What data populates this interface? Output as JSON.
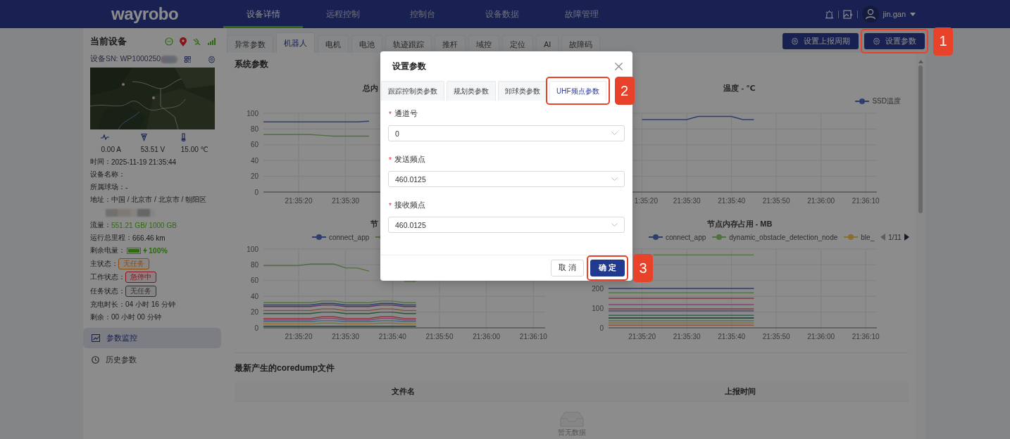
{
  "topbar": {
    "logo": "wayrobo",
    "nav": [
      {
        "label": "设备详情",
        "selected": true
      },
      {
        "label": "远程控制",
        "selected": false
      },
      {
        "label": "控制台",
        "selected": false
      },
      {
        "label": "设备数据",
        "selected": false
      },
      {
        "label": "故障管理",
        "selected": false
      }
    ],
    "user": {
      "name": "jin.gan"
    }
  },
  "sidebar": {
    "title": "当前设备",
    "sn_label": "设备SN: WP1000250",
    "map": {
      "kind": "picture"
    },
    "stats": [
      "0.00 A",
      "53.51 V",
      "15.00 ℃"
    ],
    "info": [
      {
        "kind": "text",
        "label": "时间：",
        "value": "2025-11-19 21:35:44"
      },
      {
        "kind": "text",
        "label": "设备名称："
      },
      {
        "kind": "text",
        "label": "所属球场：",
        "value": "-"
      },
      {
        "kind": "text",
        "label": "地址：",
        "value": "中国 / 北京市 / 北京市 / 朝阳区"
      },
      {
        "kind": "redacted"
      },
      {
        "kind": "text",
        "label": "流量：",
        "value": "551.21 GB/ 1000 GB",
        "color": "#2d6c0e"
      },
      {
        "kind": "text",
        "label": "运行总里程：",
        "value": "666.46 km"
      },
      {
        "kind": "battery",
        "label": "剩余电量：",
        "level": 1,
        "value": "100%"
      },
      {
        "kind": "tag",
        "label": "主状态：",
        "value": "无任务",
        "color": "#8a4d0c"
      },
      {
        "kind": "tag",
        "label": "工作状态：",
        "value": "急停中",
        "color": "#871319"
      },
      {
        "kind": "tag",
        "label": "任务状态：",
        "value": "无任务",
        "color": "#313131"
      },
      {
        "kind": "text",
        "label": "充电时长：",
        "value": "04 小时 16 分钟"
      },
      {
        "kind": "text",
        "label": "剩余：",
        "value": "00 小时 00 分钟"
      }
    ],
    "menu": [
      {
        "label": "参数监控",
        "selected": true
      },
      {
        "label": "历史参数",
        "selected": false
      }
    ]
  },
  "main_tabs": [
    {
      "label": "异常参数",
      "selected": false
    },
    {
      "label": "机器人",
      "selected": true
    },
    {
      "label": "电机",
      "selected": false
    },
    {
      "label": "电池",
      "selected": false
    },
    {
      "label": "轨迹跟踪",
      "selected": false
    },
    {
      "label": "推杆",
      "selected": false
    },
    {
      "label": "域控",
      "selected": false
    },
    {
      "label": "定位",
      "selected": false
    },
    {
      "label": "AI",
      "selected": false
    },
    {
      "label": "故障码",
      "selected": false
    }
  ],
  "actions": [
    {
      "label": "设置上报周期"
    },
    {
      "label": "设置参数",
      "annotation": "1"
    }
  ],
  "panel": {
    "title": "系统参数",
    "charts": [
      {
        "chart_data": {
          "type": "line",
          "title": "总内",
          "grid": true,
          "ylim": [
            0,
            100
          ],
          "yticks": [
            0,
            20,
            40,
            60,
            80,
            100
          ],
          "categories": [
            null,
            null,
            null,
            "21:35:20",
            null,
            null,
            null,
            "21:35:30",
            null,
            null,
            null,
            null,
            null,
            null,
            null,
            null,
            null,
            null,
            null,
            null,
            null,
            null,
            null,
            null,
            null
          ],
          "series": [
            {
              "color": "#2e3e6d",
              "values": [
                89,
                89,
                89,
                89,
                89,
                89,
                89,
                89,
                89,
                90,
                null,
                null,
                null,
                null,
                null,
                null,
                null,
                null,
                null,
                null,
                null,
                null,
                null,
                null,
                null
              ]
            },
            {
              "color": "#507040",
              "values": [
                73,
                73,
                73,
                73,
                73,
                72,
                71,
                71,
                71,
                71,
                null,
                null,
                null,
                null,
                null,
                null,
                null,
                null,
                null,
                null,
                null,
                null,
                null,
                null,
                null
              ]
            }
          ]
        }
      },
      {
        "partial_tick_label": "1:35:20",
        "chart_data": {
          "type": "line",
          "title": "温度 - ℃",
          "grid": true,
          "ylim": [
            0,
            100
          ],
          "categories": [
            null,
            null,
            null,
            null,
            null,
            null,
            null,
            "21:35:30",
            null,
            null,
            null,
            "21:35:40",
            null,
            null,
            null,
            "21:35:50",
            null,
            null,
            null,
            "21:36:00",
            null,
            null,
            null,
            "21:36:10",
            null
          ],
          "series": [
            {
              "name": "SSD温度",
              "color": "#2e3e6d",
              "values": [
                null,
                null,
                null,
                92,
                92,
                92,
                92,
                92,
                96,
                96,
                96,
                96,
                92,
                92,
                null,
                null,
                null,
                null,
                null,
                null,
                null,
                null,
                null,
                null,
                null
              ]
            }
          ]
        }
      },
      {
        "chart_data": {
          "type": "line",
          "title": "节",
          "grid": true,
          "ylim": [
            0,
            100
          ],
          "yticks": [
            0,
            20,
            40,
            60,
            80,
            100
          ],
          "categories": [
            null,
            null,
            null,
            "21:35:20",
            null,
            null,
            null,
            "21:35:30",
            null,
            null,
            null,
            "21:35:40",
            null,
            null,
            null,
            "21:35:50",
            null,
            null,
            null,
            "21:36:00",
            null,
            null,
            null,
            "21:36:10",
            null
          ],
          "series": [
            {
              "name": "connect_app",
              "color": "#2e3e6d",
              "values": [
                29,
                29,
                29,
                29,
                29,
                31,
                31,
                29,
                29,
                29,
                31,
                31,
                29,
                29,
                null,
                null,
                null,
                null,
                null,
                null,
                null,
                null,
                null,
                null,
                null
              ]
            },
            {
              "color": "#507040",
              "values": [
                79,
                79,
                79,
                79,
                81,
                81,
                81,
                76,
                76,
                72,
                null,
                null,
                59,
                59,
                null,
                null,
                null,
                null,
                null,
                null,
                null,
                null,
                null,
                null,
                null
              ]
            },
            {
              "color": "#587246",
              "values": [
                32,
                32,
                32,
                32,
                32,
                34,
                34,
                32,
                32,
                32,
                34,
                34,
                32,
                32,
                null,
                null,
                null,
                null,
                null,
                null,
                null,
                null,
                null,
                null,
                null
              ]
            },
            {
              "color": "#553563",
              "values": [
                27,
                27,
                27,
                27,
                27,
                29,
                29,
                27,
                27,
                27,
                29,
                29,
                27,
                27,
                null,
                null,
                null,
                null,
                null,
                null,
                null,
                null,
                null,
                null,
                null
              ]
            },
            {
              "color": "#8b492d",
              "values": [
                22,
                22,
                22,
                22,
                22,
                24,
                24,
                22,
                22,
                22,
                24,
                24,
                22,
                22,
                null,
                null,
                null,
                null,
                null,
                null,
                null,
                null,
                null,
                null,
                null
              ]
            },
            {
              "color": "#20593f",
              "values": [
                18,
                18,
                18,
                18,
                18,
                20,
                20,
                18,
                18,
                18,
                20,
                20,
                18,
                18,
                null,
                null,
                null,
                null,
                null,
                null,
                null,
                null,
                null,
                null,
                null
              ]
            },
            {
              "color": "#833838",
              "values": [
                12,
                12,
                12,
                12,
                12,
                14,
                14,
                12,
                12,
                12,
                14,
                14,
                12,
                12,
                null,
                null,
                null,
                null,
                null,
                null,
                null,
                null,
                null,
                null,
                null
              ]
            },
            {
              "color": "#814470",
              "values": [
                10,
                10,
                10,
                10,
                10,
                12,
                12,
                10,
                10,
                10,
                12,
                12,
                10,
                10,
                null,
                null,
                null,
                null,
                null,
                null,
                null,
                null,
                null,
                null,
                null
              ]
            },
            {
              "color": "#3f6a7a",
              "values": [
                8,
                8,
                8,
                8,
                8,
                9,
                9,
                8,
                8,
                8,
                9,
                9,
                8,
                8,
                null,
                null,
                null,
                null,
                null,
                null,
                null,
                null,
                null,
                null,
                null
              ]
            },
            {
              "color": "#8a6e30",
              "values": [
                5,
                5,
                5,
                5,
                5,
                6,
                6,
                5,
                5,
                5,
                6,
                6,
                5,
                5,
                null,
                null,
                null,
                null,
                null,
                null,
                null,
                null,
                null,
                null,
                null
              ]
            },
            {
              "color": "#19452b",
              "values": [
                2,
                2,
                2,
                2,
                2,
                2,
                2,
                2,
                2,
                2,
                2,
                2,
                2,
                2,
                null,
                null,
                null,
                null,
                null,
                null,
                null,
                null,
                null,
                null,
                null
              ]
            }
          ]
        }
      },
      {
        "legend_pager": "1/11",
        "chart_data": {
          "type": "line",
          "title": "节点内存占用 - MB",
          "grid": true,
          "ylim": [
            0,
            400
          ],
          "yticks": [
            0,
            100,
            200
          ],
          "categories": [
            null,
            null,
            null,
            "21:35:20",
            null,
            null,
            null,
            "21:35:30",
            null,
            null,
            null,
            "21:35:40",
            null,
            null,
            null,
            "21:35:50",
            null,
            null,
            null,
            "21:36:00",
            null,
            null,
            null,
            "21:36:10",
            null
          ],
          "series": [
            {
              "name": "connect_app",
              "color": "#2e3e6d",
              "values": [
                200,
                200,
                200,
                200,
                200,
                200,
                200,
                200,
                200,
                200,
                200,
                200,
                200,
                200,
                null,
                null,
                null,
                null,
                null,
                null,
                null,
                null,
                null,
                null,
                null
              ]
            },
            {
              "name": "dynamic_obstacle_detection_node",
              "color": "#507040",
              "values": [
                null,
                null,
                null,
                null,
                370,
                370,
                370,
                370,
                370,
                370,
                370,
                370,
                370,
                370,
                null,
                null,
                null,
                null,
                null,
                null,
                null,
                null,
                null,
                null,
                null
              ]
            },
            {
              "name": "ble_",
              "color": "#8a6e30",
              "values": [
                25,
                25,
                25,
                25,
                25,
                25,
                25,
                25,
                25,
                25,
                25,
                25,
                25,
                25,
                null,
                null,
                null,
                null,
                null,
                null,
                null,
                null,
                null,
                null,
                null
              ]
            },
            {
              "color": "#577243",
              "values": [
                178,
                178,
                178,
                178,
                178,
                178,
                178,
                178,
                178,
                178,
                178,
                178,
                178,
                178,
                null,
                null,
                null,
                null,
                null,
                null,
                null,
                null,
                null,
                null,
                null
              ]
            },
            {
              "color": "#833838",
              "values": [
                150,
                150,
                150,
                150,
                150,
                150,
                150,
                150,
                150,
                150,
                150,
                150,
                150,
                150,
                null,
                null,
                null,
                null,
                null,
                null,
                null,
                null,
                null,
                null,
                null
              ]
            },
            {
              "color": "#814470",
              "values": [
                118,
                118,
                118,
                118,
                118,
                118,
                118,
                118,
                118,
                118,
                118,
                118,
                118,
                118,
                null,
                null,
                null,
                null,
                null,
                null,
                null,
                null,
                null,
                null,
                null
              ]
            },
            {
              "color": "#732935",
              "values": [
                96,
                96,
                96,
                96,
                96,
                96,
                96,
                96,
                96,
                96,
                96,
                96,
                96,
                96,
                null,
                null,
                null,
                null,
                null,
                null,
                null,
                null,
                null,
                null,
                null
              ]
            },
            {
              "color": "#553563",
              "values": [
                86,
                86,
                86,
                86,
                86,
                86,
                86,
                86,
                86,
                86,
                86,
                86,
                86,
                86,
                null,
                null,
                null,
                null,
                null,
                null,
                null,
                null,
                null,
                null,
                null
              ]
            },
            {
              "color": "#20593f",
              "values": [
                64,
                64,
                64,
                64,
                64,
                64,
                64,
                64,
                64,
                64,
                64,
                64,
                64,
                64,
                null,
                null,
                null,
                null,
                null,
                null,
                null,
                null,
                null,
                null,
                null
              ]
            },
            {
              "color": "#113b20",
              "values": [
                50,
                50,
                50,
                50,
                50,
                50,
                50,
                50,
                50,
                50,
                50,
                50,
                50,
                50,
                null,
                null,
                null,
                null,
                null,
                null,
                null,
                null,
                null,
                null,
                null
              ]
            },
            {
              "color": "#3f6a7a",
              "values": [
                36,
                36,
                36,
                36,
                36,
                36,
                36,
                36,
                36,
                36,
                36,
                36,
                36,
                36,
                null,
                null,
                null,
                null,
                null,
                null,
                null,
                null,
                null,
                null,
                null
              ]
            },
            {
              "color": "#8b492d",
              "values": [
                14,
                14,
                14,
                14,
                14,
                14,
                14,
                14,
                14,
                14,
                14,
                14,
                14,
                14,
                null,
                null,
                null,
                null,
                null,
                null,
                null,
                null,
                null,
                null,
                null
              ]
            }
          ]
        }
      }
    ],
    "coredump": {
      "title": "最新产生的coredump文件",
      "columns": [
        "文件名",
        "上报时间"
      ],
      "empty_text": "暂无数据"
    }
  },
  "dialog": {
    "title": "设置参数",
    "tabs": [
      {
        "label": "跟踪控制类参数",
        "selected": false
      },
      {
        "label": "规划类参数",
        "selected": false
      },
      {
        "label": "卸球类参数",
        "selected": false
      },
      {
        "label": "UHF频点参数",
        "selected": true,
        "annotation": "2"
      }
    ],
    "fields": [
      {
        "label": "通道号",
        "required_mark": "*",
        "value": "0"
      },
      {
        "label": "发送频点",
        "required_mark": "*",
        "value": "460.0125"
      },
      {
        "label": "接收频点",
        "required_mark": "*",
        "value": "460.0125"
      }
    ],
    "buttons": [
      {
        "label": "取 消",
        "kind": "default"
      },
      {
        "label": "确 定",
        "kind": "primary",
        "annotation": "3"
      }
    ]
  }
}
